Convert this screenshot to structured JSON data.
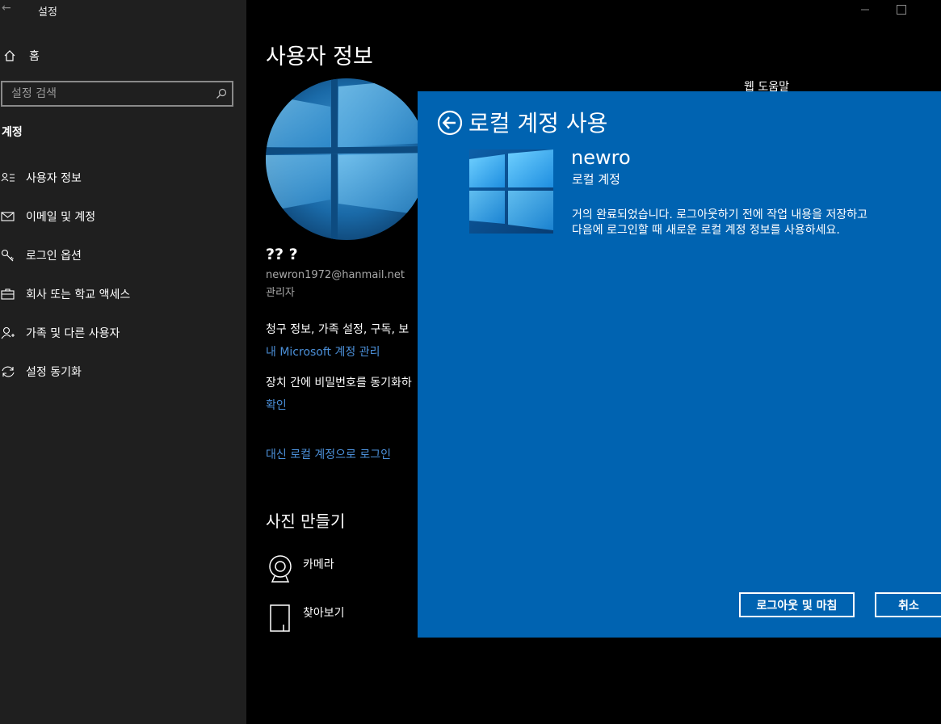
{
  "window": {
    "back_glyph": "←",
    "title": "설정"
  },
  "sidebar": {
    "home_label": "홈",
    "search_placeholder": "설정 검색",
    "section_title": "계정",
    "items": [
      {
        "label": "사용자 정보",
        "icon": "person-card-icon"
      },
      {
        "label": "이메일 및 계정",
        "icon": "mail-icon"
      },
      {
        "label": "로그인 옵션",
        "icon": "key-icon"
      },
      {
        "label": "회사 또는 학교 액세스",
        "icon": "briefcase-icon"
      },
      {
        "label": "가족 및 다른 사용자",
        "icon": "person-add-icon"
      },
      {
        "label": "설정 동기화",
        "icon": "sync-icon"
      }
    ]
  },
  "main": {
    "page_title": "사용자 정보",
    "user_name": "?? ?",
    "user_email": "newron1972@hanmail.net",
    "user_role": "관리자",
    "billing_text": "청구 정보, 가족 설정, 구독, 보",
    "ms_account_link": "내 Microsoft 계정 관리",
    "sync_text": "장치 간에 비밀번호를 동기화하",
    "verify_link": "확인",
    "local_account_link": "대신 로컬 계정으로 로그인",
    "photo_title": "사진 만들기",
    "camera_label": "카메라",
    "browse_label": "찾아보기",
    "help_text": "웹 도움말"
  },
  "dialog": {
    "title": "로컬 계정 사용",
    "account_name": "newro",
    "account_type": "로컬 계정",
    "message_line1": "거의 완료되었습니다. 로그아웃하기 전에 작업 내용을 저장하고",
    "message_line2": "다음에 로그인할 때 새로운 로컬 계정 정보를 사용하세요.",
    "signout_button": "로그아웃 및 마침",
    "cancel_button": "취소",
    "background_color": "#0063b1"
  },
  "colors": {
    "sidebar_bg": "#1f1f1f",
    "link": "#4b8fd8",
    "dialog_bg": "#0063b1"
  }
}
